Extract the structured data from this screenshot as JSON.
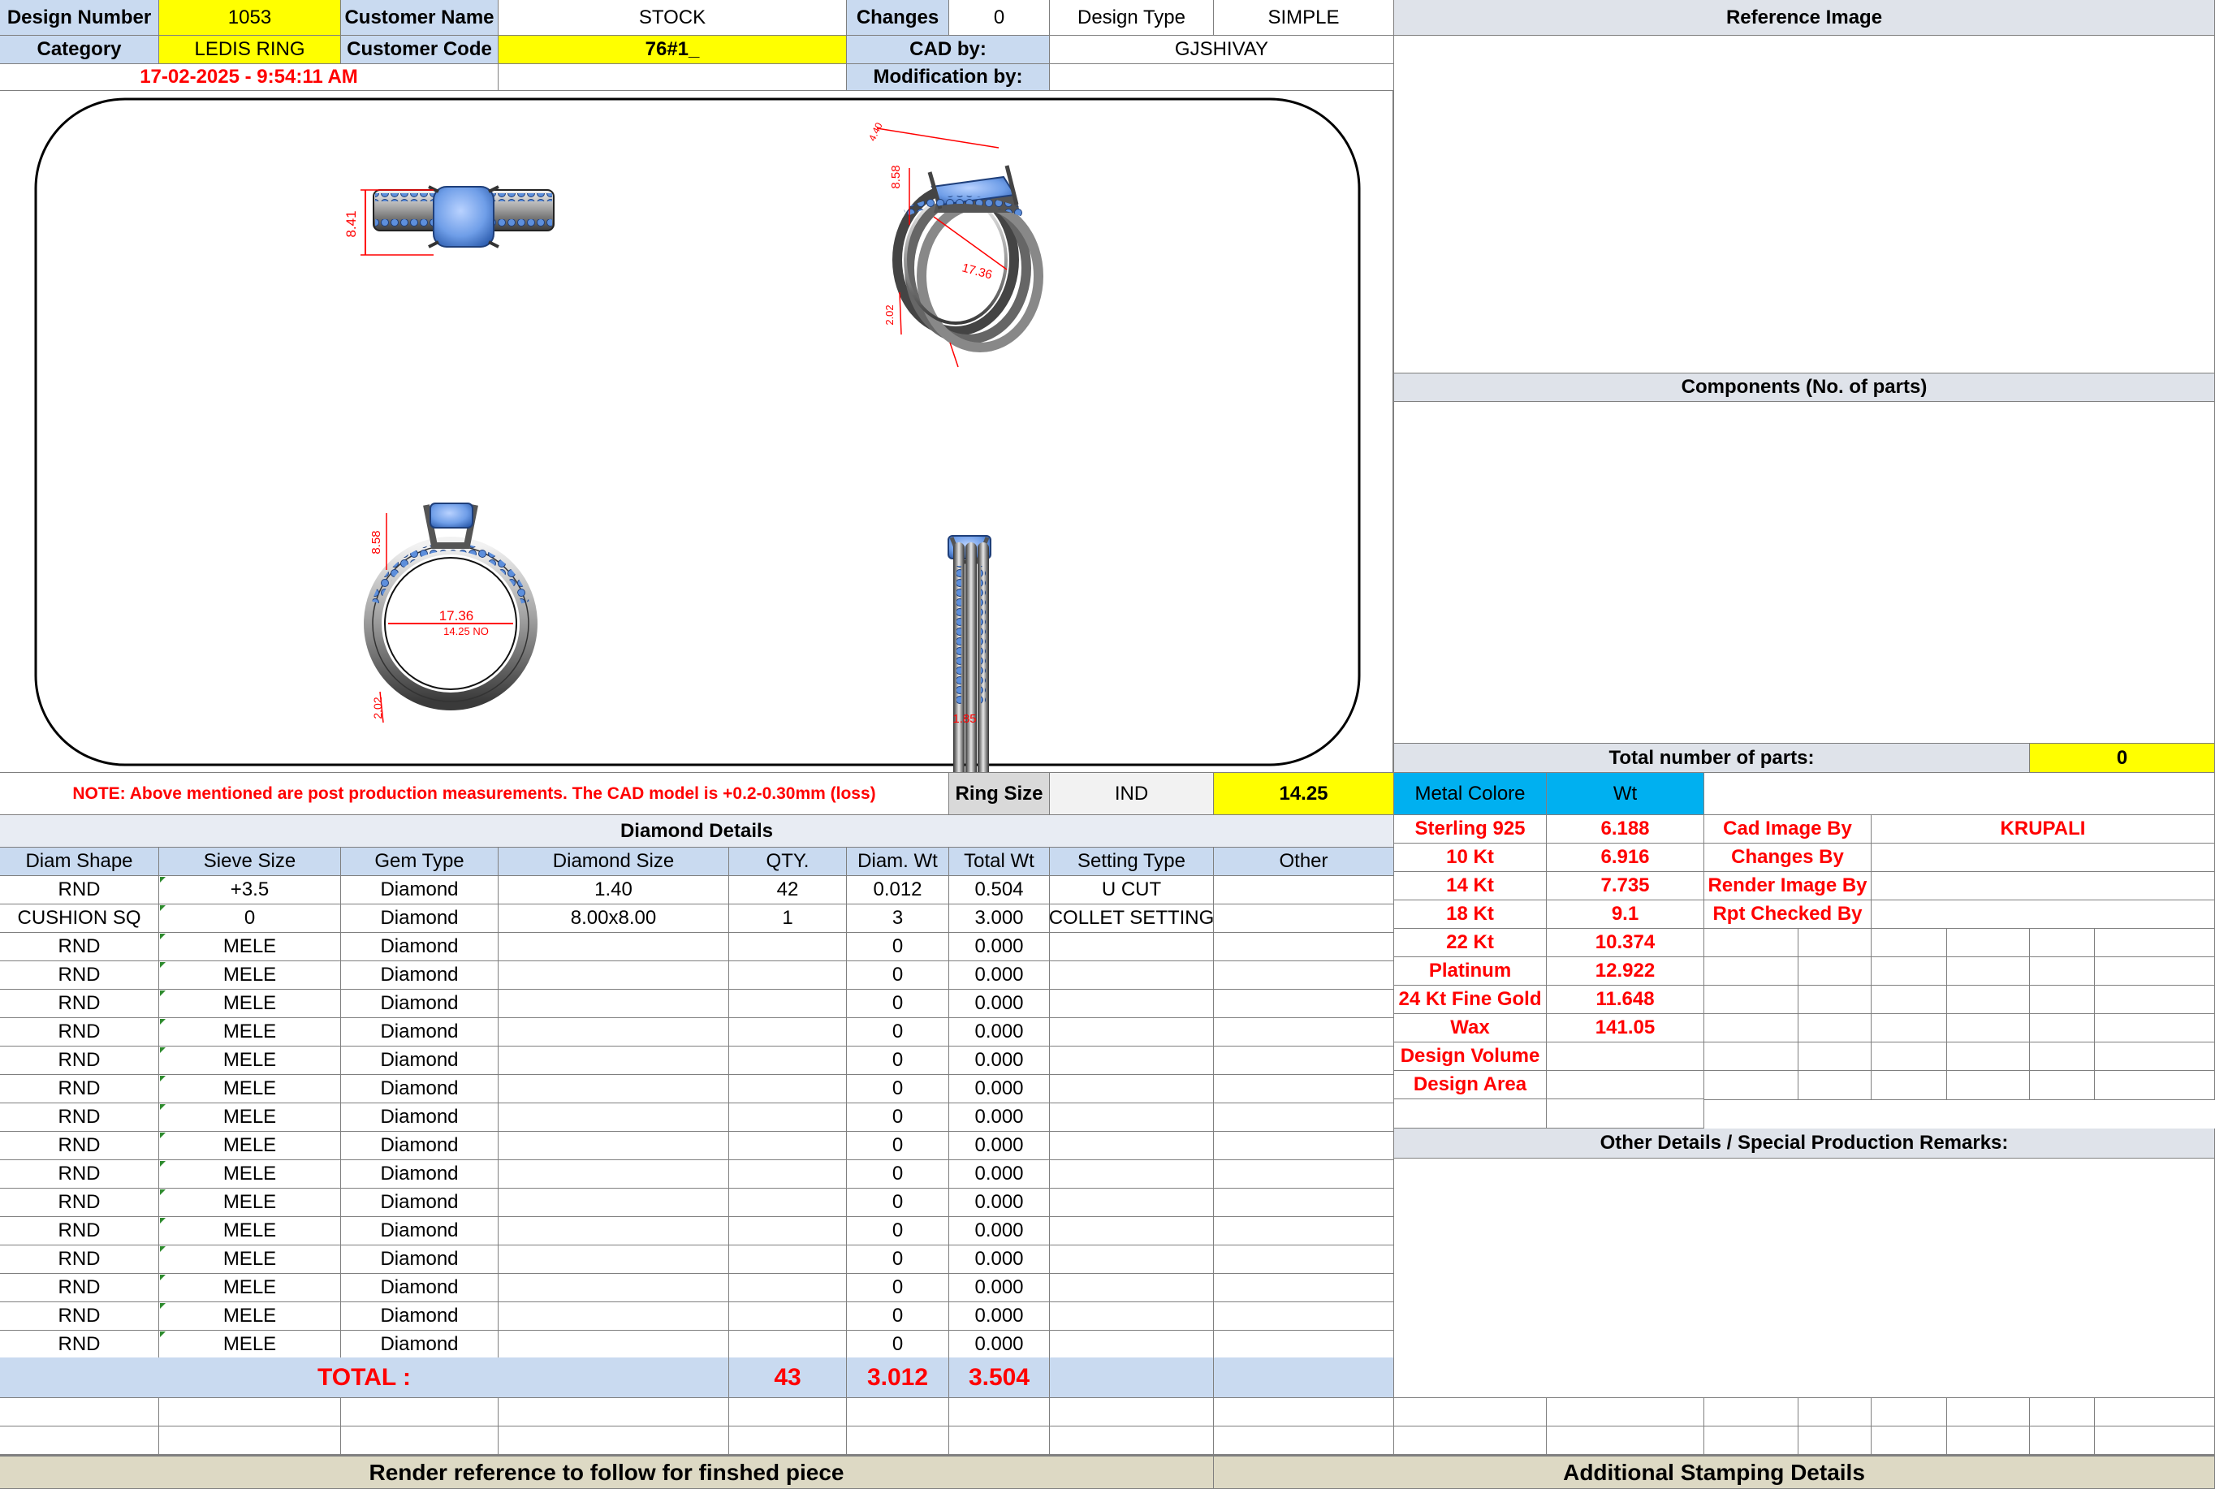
{
  "header": {
    "design_number_label": "Design Number",
    "design_number": "1053",
    "customer_name_label": "Customer Name",
    "customer_name": "STOCK",
    "changes_label": "Changes",
    "changes": "0",
    "design_type_label": "Design Type",
    "design_type": "SIMPLE",
    "category_label": "Category",
    "category": "LEDIS RING",
    "customer_code_label": "Customer Code",
    "customer_code": "76#1_",
    "cad_by_label": "CAD by:",
    "cad_by": "GJSHIVAY",
    "date": "17-02-2025 - 9:54:11 AM",
    "modification_label": "Modification by:",
    "modification_by": ""
  },
  "drawing": {
    "dims": {
      "top_height": "8.41",
      "persp_height": "8.58",
      "persp_w": "4.40",
      "persp_inner": "17.36",
      "persp_band": "2.02",
      "front_height": "8.58",
      "front_inner": "17.36",
      "front_size": "14.25 NO",
      "front_band": "2.02",
      "side_width": "1.85"
    }
  },
  "note": "NOTE: Above mentioned are post production measurements. The CAD model is +0.2-0.30mm (loss)",
  "ring_size_label": "Ring Size",
  "ring_size_std": "IND",
  "ring_size": "14.25",
  "reference_image_label": "Reference Image",
  "components_label": "Components (No. of parts)",
  "total_parts_label": "Total number of parts:",
  "total_parts": "0",
  "metal": {
    "color_label": "Metal Colore",
    "wt_label": "Wt",
    "rows": [
      {
        "name": "Sterling 925",
        "wt": "6.188"
      },
      {
        "name": "10 Kt",
        "wt": "6.916"
      },
      {
        "name": "14 Kt",
        "wt": "7.735"
      },
      {
        "name": "18 Kt",
        "wt": "9.1"
      },
      {
        "name": "22 Kt",
        "wt": "10.374"
      },
      {
        "name": "Platinum",
        "wt": "12.922"
      },
      {
        "name": "24 Kt Fine Gold",
        "wt": "11.648"
      },
      {
        "name": "Wax",
        "wt": "141.05"
      },
      {
        "name": "Design Volume",
        "wt": ""
      },
      {
        "name": "Design Area",
        "wt": ""
      }
    ]
  },
  "staff": [
    {
      "label": "Cad Image By",
      "value": "KRUPALI"
    },
    {
      "label": "Changes By",
      "value": ""
    },
    {
      "label": "Render Image By",
      "value": ""
    },
    {
      "label": "Rpt Checked By",
      "value": ""
    }
  ],
  "other_details_label": "Other Details / Special Production Remarks:",
  "diamond": {
    "title": "Diamond Details",
    "headers": [
      "Diam Shape",
      "Sieve Size",
      "Gem Type",
      "Diamond Size",
      "QTY.",
      "Diam. Wt",
      "Total Wt",
      "Setting Type",
      "Other"
    ],
    "rows": [
      [
        "RND",
        "+3.5",
        "Diamond",
        "1.40",
        "42",
        "0.012",
        "0.504",
        "U CUT",
        ""
      ],
      [
        "CUSHION SQ",
        "0",
        "Diamond",
        "8.00x8.00",
        "1",
        "3",
        "3.000",
        "COLLET SETTING",
        ""
      ],
      [
        "RND",
        "MELE",
        "Diamond",
        "",
        "",
        "0",
        "0.000",
        "",
        ""
      ],
      [
        "RND",
        "MELE",
        "Diamond",
        "",
        "",
        "0",
        "0.000",
        "",
        ""
      ],
      [
        "RND",
        "MELE",
        "Diamond",
        "",
        "",
        "0",
        "0.000",
        "",
        ""
      ],
      [
        "RND",
        "MELE",
        "Diamond",
        "",
        "",
        "0",
        "0.000",
        "",
        ""
      ],
      [
        "RND",
        "MELE",
        "Diamond",
        "",
        "",
        "0",
        "0.000",
        "",
        ""
      ],
      [
        "RND",
        "MELE",
        "Diamond",
        "",
        "",
        "0",
        "0.000",
        "",
        ""
      ],
      [
        "RND",
        "MELE",
        "Diamond",
        "",
        "",
        "0",
        "0.000",
        "",
        ""
      ],
      [
        "RND",
        "MELE",
        "Diamond",
        "",
        "",
        "0",
        "0.000",
        "",
        ""
      ],
      [
        "RND",
        "MELE",
        "Diamond",
        "",
        "",
        "0",
        "0.000",
        "",
        ""
      ],
      [
        "RND",
        "MELE",
        "Diamond",
        "",
        "",
        "0",
        "0.000",
        "",
        ""
      ],
      [
        "RND",
        "MELE",
        "Diamond",
        "",
        "",
        "0",
        "0.000",
        "",
        ""
      ],
      [
        "RND",
        "MELE",
        "Diamond",
        "",
        "",
        "0",
        "0.000",
        "",
        ""
      ],
      [
        "RND",
        "MELE",
        "Diamond",
        "",
        "",
        "0",
        "0.000",
        "",
        ""
      ],
      [
        "RND",
        "MELE",
        "Diamond",
        "",
        "",
        "0",
        "0.000",
        "",
        ""
      ],
      [
        "RND",
        "MELE",
        "Diamond",
        "",
        "",
        "0",
        "0.000",
        "",
        ""
      ]
    ],
    "total_label": "TOTAL :",
    "total_qty": "43",
    "total_diam_wt": "3.012",
    "total_wt": "3.504"
  },
  "footer": {
    "render_ref": "Render reference to follow for finshed piece",
    "stamping": "Additional Stamping Details"
  },
  "colors": {
    "header_blue": "#c9daf0",
    "highlight_yellow": "#ffff00",
    "red_text": "#ff0000",
    "metal_cyan": "#00b0f0",
    "footer_tan": "#ddd9c4",
    "stone_blue": "#6f9ee8"
  }
}
